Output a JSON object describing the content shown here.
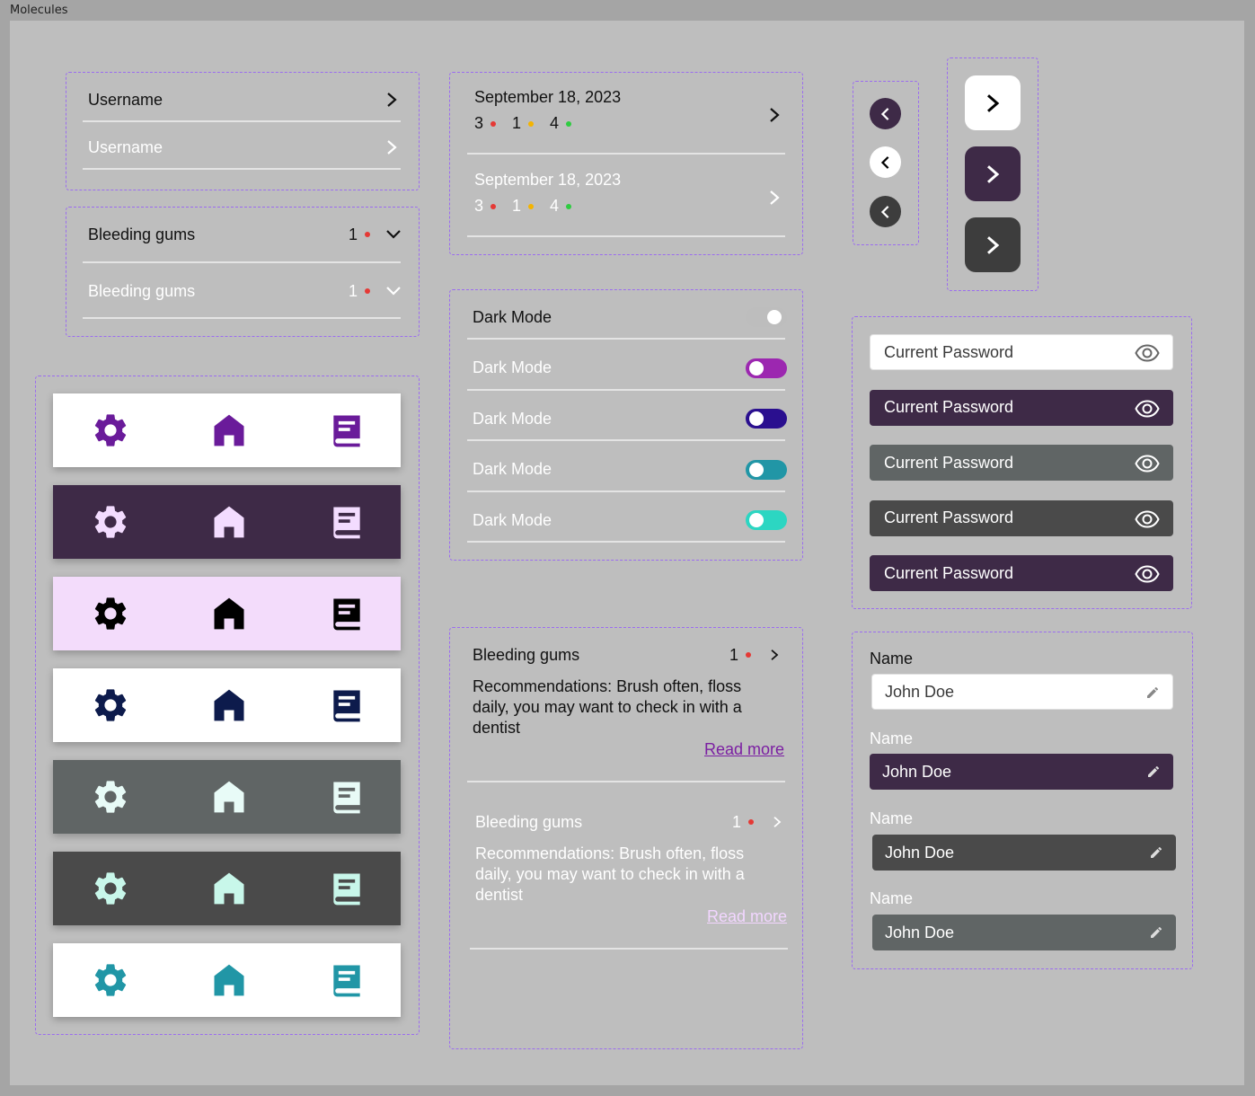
{
  "frame_title": "Molecules",
  "username_rows": [
    {
      "label": "Username",
      "color": "#111111"
    },
    {
      "label": "Username",
      "color": "#ffffff"
    }
  ],
  "symptom_rows": [
    {
      "label": "Bleeding gums",
      "count": "1",
      "color": "#111111"
    },
    {
      "label": "Bleeding gums",
      "count": "1",
      "color": "#ffffff"
    }
  ],
  "date_rows": [
    {
      "date": "September 18, 2023",
      "counts": [
        "3",
        "1",
        "4"
      ],
      "color": "#111111"
    },
    {
      "date": "September 18, 2023",
      "counts": [
        "3",
        "1",
        "4"
      ],
      "color": "#ffffff"
    }
  ],
  "toggle_rows": [
    {
      "label": "Dark Mode",
      "track": "#bdbdbd",
      "text": "#111111"
    },
    {
      "label": "Dark Mode",
      "track": "#9c27b0",
      "text": "#ffffff"
    },
    {
      "label": "Dark Mode",
      "track": "#2a0f8f",
      "text": "#ffffff"
    },
    {
      "label": "Dark Mode",
      "track": "#2196a6",
      "text": "#ffffff"
    },
    {
      "label": "Dark Mode",
      "track": "#2cd6c2",
      "text": "#ffffff"
    }
  ],
  "recommendations": [
    {
      "title": "Bleeding gums",
      "count": "1",
      "text": "Recommendations: Brush often, floss daily, you may want to check in with a dentist",
      "link": "Read more",
      "color": "#111111",
      "link_color": "#7b1fa2"
    },
    {
      "title": "Bleeding gums",
      "count": "1",
      "text": "Recommendations: Brush often, floss daily, you may want to check in with a dentist",
      "link": "Read more",
      "color": "#ffffff",
      "link_color": "#f2d6ff"
    }
  ],
  "navbars": [
    {
      "bg": "#ffffff",
      "icon": "#6a1b9a"
    },
    {
      "bg": "#3e2a47",
      "icon": "#f3dcff"
    },
    {
      "bg": "#f3dcfb",
      "icon": "#000000"
    },
    {
      "bg": "#ffffff",
      "icon": "#0d1b4c"
    },
    {
      "bg": "#606565",
      "icon": "#e8fbf7"
    },
    {
      "bg": "#4a4a4a",
      "icon": "#c8f7ea"
    },
    {
      "bg": "#ffffff",
      "icon": "#2196a6"
    }
  ],
  "nav_icons": [
    "gear-icon",
    "home-icon",
    "book-icon"
  ],
  "small_back_buttons": [
    {
      "bg": "#3e2a47",
      "fg": "#ffffff"
    },
    {
      "bg": "#ffffff",
      "fg": "#000000"
    },
    {
      "bg": "#3d3d3d",
      "fg": "#ffffff"
    }
  ],
  "big_next_buttons": [
    {
      "bg": "#ffffff",
      "fg": "#000000"
    },
    {
      "bg": "#3e2a47",
      "fg": "#ffffff"
    },
    {
      "bg": "#3d3d3d",
      "fg": "#ffffff"
    }
  ],
  "password_fields": [
    {
      "placeholder": "Current Password",
      "bg": "#ffffff",
      "fg": "#3a3a3a",
      "border": "#e0e0e0"
    },
    {
      "placeholder": "Current Password",
      "bg": "#3e2a47",
      "fg": "#ffffff",
      "border": "#3e2a47"
    },
    {
      "placeholder": "Current Password",
      "bg": "#606565",
      "fg": "#ffffff",
      "border": "#606565"
    },
    {
      "placeholder": "Current Password",
      "bg": "#4a4a4a",
      "fg": "#ffffff",
      "border": "#4a4a4a"
    },
    {
      "placeholder": "Current Password",
      "bg": "#3e2a47",
      "fg": "#ffffff",
      "border": "#3e2a47"
    }
  ],
  "name_fields": [
    {
      "label": "Name",
      "value": "John Doe",
      "bg": "#ffffff",
      "fg": "#3a3a3a",
      "label_color": "#111111"
    },
    {
      "label": "Name",
      "value": "John Doe",
      "bg": "#3e2a47",
      "fg": "#ffffff",
      "label_color": "#ffffff"
    },
    {
      "label": "Name",
      "value": "John Doe",
      "bg": "#4a4a4a",
      "fg": "#ffffff",
      "label_color": "#ffffff"
    },
    {
      "label": "Name",
      "value": "John Doe",
      "bg": "#606565",
      "fg": "#ffffff",
      "label_color": "#ffffff"
    }
  ],
  "dot_colors": {
    "red": "#e53935",
    "yellow": "#f4b400",
    "green": "#2ecc40"
  },
  "accent": "#9b6cf0"
}
